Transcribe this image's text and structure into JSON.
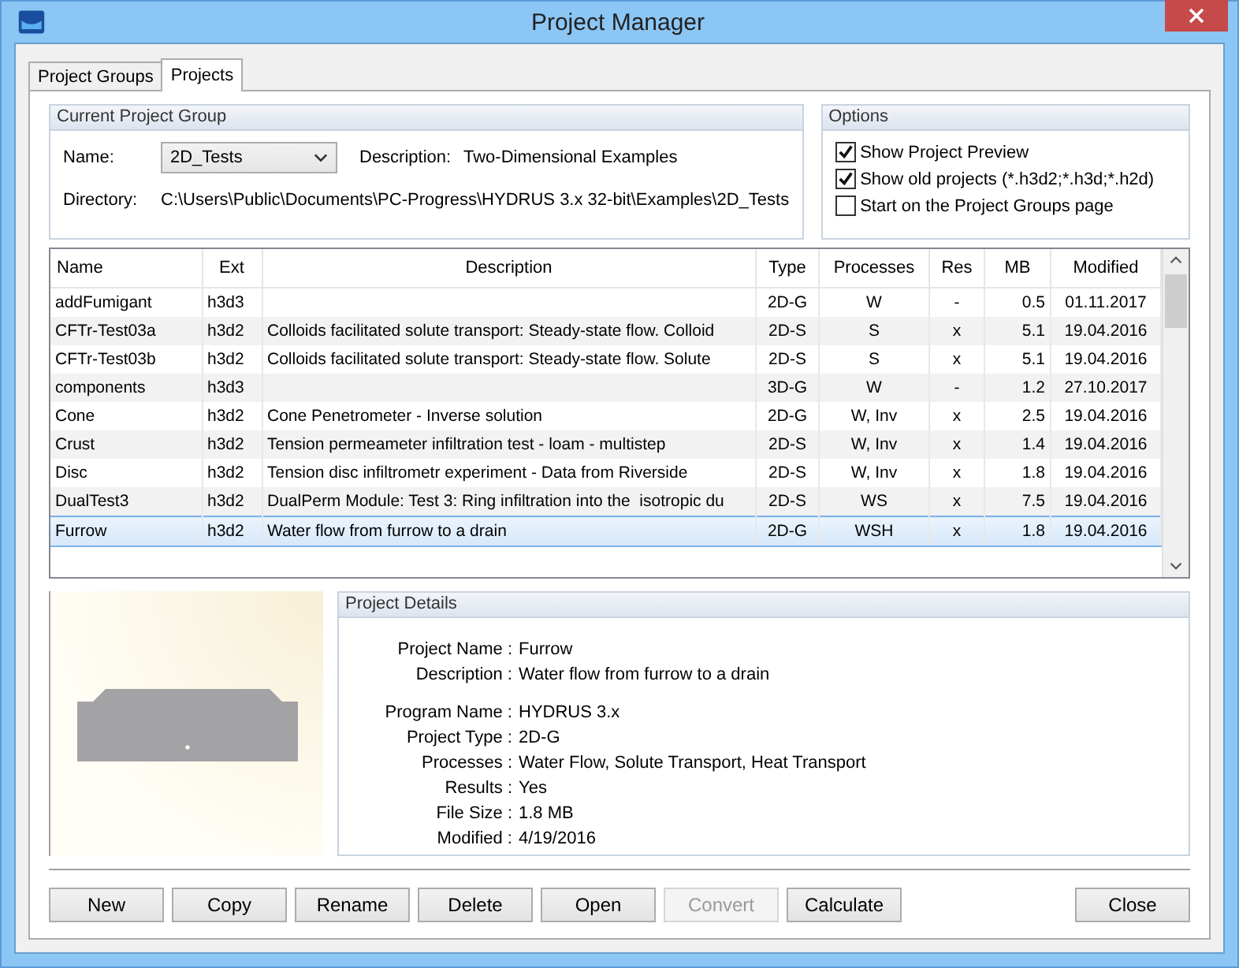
{
  "window": {
    "title": "Project Manager"
  },
  "tabs": [
    {
      "label": "Project Groups",
      "selected": false
    },
    {
      "label": "Projects",
      "selected": true
    }
  ],
  "current_project_group": {
    "title": "Current Project Group",
    "name_label": "Name:",
    "name_value": "2D_Tests",
    "description_label": "Description:",
    "description_value": "Two-Dimensional Examples",
    "directory_label": "Directory:",
    "directory_value": "C:\\Users\\Public\\Documents\\PC-Progress\\HYDRUS 3.x 32-bit\\Examples\\2D_Tests"
  },
  "options": {
    "title": "Options",
    "items": [
      {
        "label": "Show Project Preview",
        "checked": true
      },
      {
        "label": "Show old projects (*.h3d2;*.h3d;*.h2d)",
        "checked": true
      },
      {
        "label": "Start on the Project Groups page",
        "checked": false
      }
    ]
  },
  "table": {
    "columns": [
      "Name",
      "Ext",
      "Description",
      "Type",
      "Processes",
      "Res",
      "MB",
      "Modified"
    ],
    "rows": [
      {
        "cells": [
          "addFumigant",
          "h3d3",
          "",
          "2D-G",
          "W",
          "-",
          "0.5",
          "01.11.2017"
        ],
        "selected": false
      },
      {
        "cells": [
          "CFTr-Test03a",
          "h3d2",
          "Colloids facilitated solute transport: Steady-state flow. Colloid",
          "2D-S",
          "S",
          "x",
          "5.1",
          "19.04.2016"
        ],
        "selected": false
      },
      {
        "cells": [
          "CFTr-Test03b",
          "h3d2",
          "Colloids facilitated solute transport: Steady-state flow. Solute",
          "2D-S",
          "S",
          "x",
          "5.1",
          "19.04.2016"
        ],
        "selected": false
      },
      {
        "cells": [
          "components",
          "h3d3",
          "",
          "3D-G",
          "W",
          "-",
          "1.2",
          "27.10.2017"
        ],
        "selected": false
      },
      {
        "cells": [
          "Cone",
          "h3d2",
          "Cone Penetrometer - Inverse solution",
          "2D-G",
          "W, Inv",
          "x",
          "2.5",
          "19.04.2016"
        ],
        "selected": false
      },
      {
        "cells": [
          "Crust",
          "h3d2",
          "Tension permeameter infiltration test - loam - multistep",
          "2D-S",
          "W, Inv",
          "x",
          "1.4",
          "19.04.2016"
        ],
        "selected": false
      },
      {
        "cells": [
          "Disc",
          "h3d2",
          "Tension disc infiltrometr experiment - Data from Riverside",
          "2D-S",
          "W, Inv",
          "x",
          "1.8",
          "19.04.2016"
        ],
        "selected": false
      },
      {
        "cells": [
          "DualTest3",
          "h3d2",
          "DualPerm Module: Test 3: Ring infiltration into the  isotropic du",
          "2D-S",
          "WS",
          "x",
          "7.5",
          "19.04.2016"
        ],
        "selected": false
      },
      {
        "cells": [
          "Furrow",
          "h3d2",
          "Water flow from furrow to a drain",
          "2D-G",
          "WSH",
          "x",
          "1.8",
          "19.04.2016"
        ],
        "selected": true
      }
    ]
  },
  "project_details": {
    "title": "Project Details",
    "groups": [
      [
        {
          "label": "Project Name :",
          "value": "Furrow"
        },
        {
          "label": "Description :",
          "value": "Water flow from furrow to a drain"
        }
      ],
      [
        {
          "label": "Program Name :",
          "value": "HYDRUS 3.x"
        },
        {
          "label": "Project Type :",
          "value": "2D-G"
        },
        {
          "label": "Processes :",
          "value": "Water Flow, Solute Transport, Heat Transport"
        },
        {
          "label": "Results :",
          "value": "Yes"
        },
        {
          "label": "File Size :",
          "value": "1.8 MB"
        },
        {
          "label": "Modified :",
          "value": "4/19/2016"
        }
      ]
    ]
  },
  "buttons": [
    {
      "label": "New",
      "disabled": false
    },
    {
      "label": "Copy",
      "disabled": false
    },
    {
      "label": "Rename",
      "disabled": false
    },
    {
      "label": "Delete",
      "disabled": false
    },
    {
      "label": "Open",
      "disabled": false
    },
    {
      "label": "Convert",
      "disabled": true
    },
    {
      "label": "Calculate",
      "disabled": false
    }
  ],
  "close_button": {
    "label": "Close"
  }
}
